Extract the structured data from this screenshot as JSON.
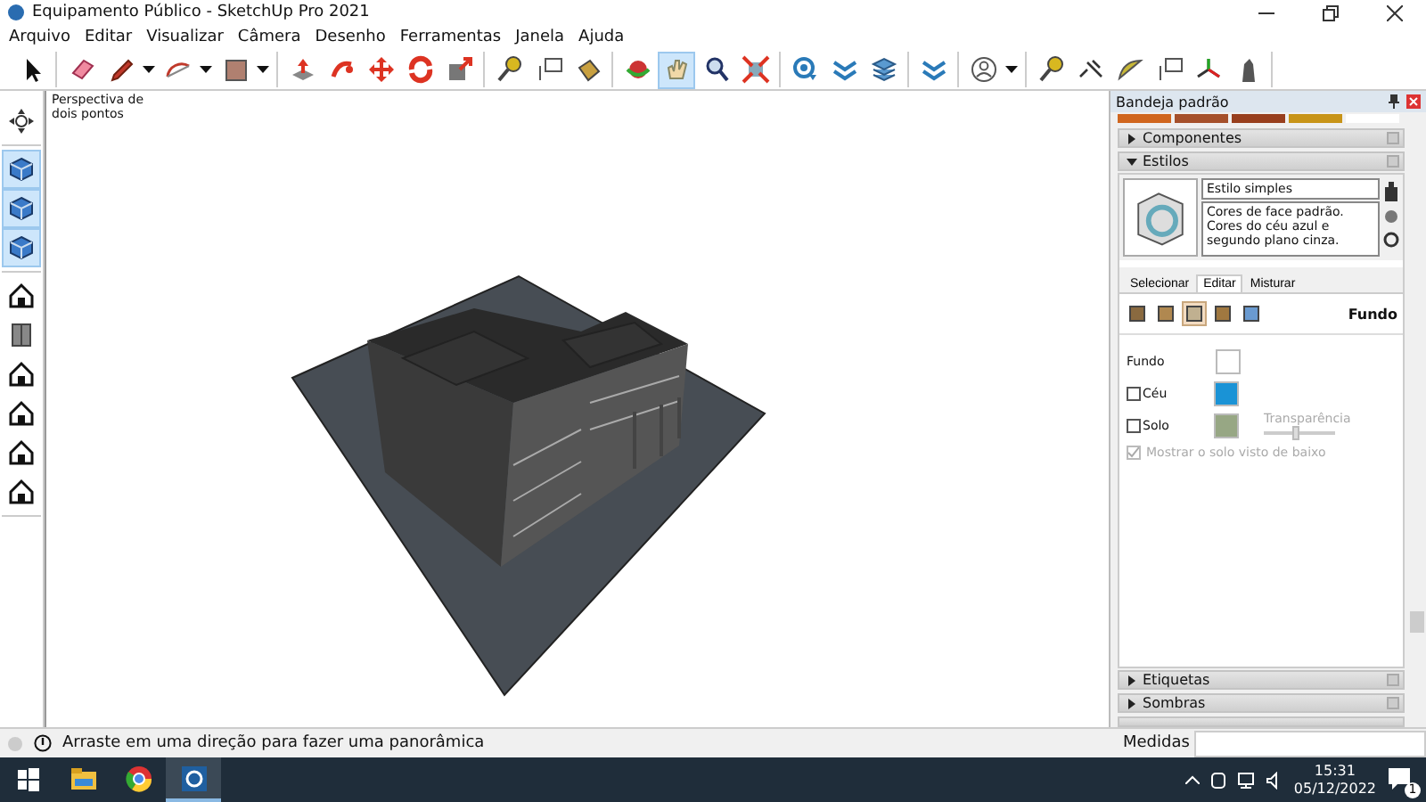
{
  "window": {
    "title": "Equipamento Público - SketchUp Pro 2021"
  },
  "menu": [
    "Arquivo",
    "Editar",
    "Visualizar",
    "Câmera",
    "Desenho",
    "Ferramentas",
    "Janela",
    "Ajuda"
  ],
  "toolbar": {
    "groups": [
      [
        {
          "kind": "arrow",
          "selected": false
        }
      ],
      [
        {
          "kind": "eraser",
          "selected": false
        },
        {
          "kind": "pencil",
          "selected": false,
          "dropdown": true
        },
        {
          "kind": "arc",
          "selected": false,
          "dropdown": true
        },
        {
          "kind": "rectangle",
          "selected": false,
          "dropdown": true
        }
      ],
      [
        {
          "kind": "pushpull",
          "selected": false
        },
        {
          "kind": "followme",
          "selected": false
        },
        {
          "kind": "move",
          "selected": false
        },
        {
          "kind": "rotate",
          "selected": false
        },
        {
          "kind": "scale",
          "selected": false
        }
      ],
      [
        {
          "kind": "tape",
          "selected": false
        },
        {
          "kind": "label",
          "selected": false
        },
        {
          "kind": "bucket",
          "selected": false
        }
      ],
      [
        {
          "kind": "orbit",
          "selected": false
        },
        {
          "kind": "hand",
          "selected": true
        },
        {
          "kind": "magnifier",
          "selected": false
        },
        {
          "kind": "extents",
          "selected": false
        }
      ],
      [
        {
          "kind": "globe",
          "selected": false
        },
        {
          "kind": "wave",
          "selected": false
        },
        {
          "kind": "stack",
          "selected": false
        }
      ],
      [
        {
          "kind": "wave",
          "selected": false
        }
      ],
      [
        {
          "kind": "person",
          "selected": false,
          "dropdown": true
        }
      ],
      [
        {
          "kind": "tape",
          "selected": false
        },
        {
          "kind": "dimension",
          "selected": false
        },
        {
          "kind": "protractor",
          "selected": false
        },
        {
          "kind": "label",
          "selected": false
        },
        {
          "kind": "axes",
          "selected": false
        },
        {
          "kind": "figure",
          "selected": false
        }
      ]
    ]
  },
  "side_toolbar": {
    "groups": [
      [
        {
          "kind": "pan",
          "selected": false
        }
      ],
      [
        {
          "kind": "cube",
          "selected": true
        },
        {
          "kind": "cube",
          "selected": true
        },
        {
          "kind": "cube",
          "selected": true
        }
      ],
      [
        {
          "kind": "house",
          "selected": false
        },
        {
          "kind": "front",
          "selected": false
        },
        {
          "kind": "house",
          "selected": false
        },
        {
          "kind": "house",
          "selected": false
        },
        {
          "kind": "house",
          "selected": false
        },
        {
          "kind": "house",
          "selected": false
        }
      ]
    ]
  },
  "viewport": {
    "camera_label": "Perspectiva de dois pontos"
  },
  "tray": {
    "title": "Bandeja padrão",
    "swatches": [
      {
        "color": "#d0661f"
      },
      {
        "color": "#a5502b"
      },
      {
        "color": "#983f1e"
      },
      {
        "color": "#c89418"
      },
      {
        "color": "#ffffff"
      }
    ],
    "panels_top": [
      {
        "title": "Componentes",
        "expanded": false
      },
      {
        "title": "Estilos",
        "expanded": true
      }
    ],
    "styles": {
      "name": "Estilo simples",
      "description": "Cores de face padrão. Cores do céu azul e segundo plano cinza.",
      "tabs": [
        {
          "label": "Selecionar",
          "selected": false
        },
        {
          "label": "Editar",
          "selected": true
        },
        {
          "label": "Misturar",
          "selected": false
        }
      ],
      "edit_icons": [
        {
          "selected": false
        },
        {
          "selected": false
        },
        {
          "selected": true
        },
        {
          "selected": false
        },
        {
          "selected": false
        }
      ],
      "section": "Fundo",
      "rows": [
        {
          "kind": "plain",
          "label": "Fundo",
          "color": "#ffffff"
        },
        {
          "kind": "check",
          "label": "Céu",
          "checked": false,
          "color": "#1a93d6"
        },
        {
          "kind": "check",
          "label": "Solo",
          "checked": false,
          "color": "#97a784"
        }
      ],
      "transparency": {
        "label": "Transparência",
        "level": 0.45,
        "disabled": true
      },
      "show_ground": {
        "label": "Mostrar o solo visto de baixo",
        "checked": true,
        "disabled": true
      }
    },
    "panels_bottom": [
      {
        "title": "Etiquetas",
        "expanded": false
      },
      {
        "title": "Sombras",
        "expanded": false
      }
    ]
  },
  "status_bar": {
    "message": "Arraste em uma direção para fazer uma panorâmica",
    "measure_label": "Medidas"
  },
  "taskbar": {
    "apps": [
      {
        "kind": "start",
        "active": false
      },
      {
        "kind": "folder",
        "active": false
      },
      {
        "kind": "browser",
        "active": false
      },
      {
        "kind": "sketchup",
        "active": true
      }
    ],
    "time": "15:31",
    "date": "05/12/2022",
    "notifications": "1"
  }
}
